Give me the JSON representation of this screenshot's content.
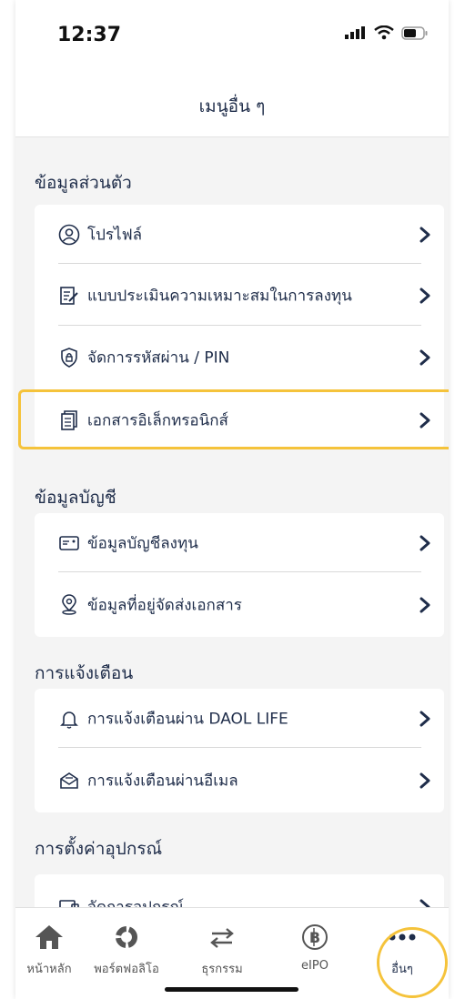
{
  "status": {
    "time": "12:37"
  },
  "header": {
    "title": "เมนูอื่น ๆ"
  },
  "sections": [
    {
      "title": "ข้อมูลส่วนตัว",
      "items": [
        {
          "label": "โปรไฟล์",
          "icon": "profile-icon"
        },
        {
          "label": "แบบประเมินความเหมาะสมในการลงทุน",
          "icon": "assessment-icon"
        },
        {
          "label": "จัดการรหัสผ่าน / PIN",
          "icon": "shield-lock-icon"
        },
        {
          "label": "เอกสารอิเล็กทรอนิกส์",
          "icon": "documents-icon"
        }
      ]
    },
    {
      "title": "ข้อมูลบัญชี",
      "items": [
        {
          "label": "ข้อมูลบัญชีลงทุน",
          "icon": "account-card-icon"
        },
        {
          "label": "ข้อมูลที่อยู่จัดส่งเอกสาร",
          "icon": "location-pin-icon"
        }
      ]
    },
    {
      "title": "การแจ้งเตือน",
      "items": [
        {
          "label": "การแจ้งเตือนผ่าน DAOL LIFE",
          "icon": "bell-icon"
        },
        {
          "label": "การแจ้งเตือนผ่านอีเมล",
          "icon": "email-icon"
        }
      ]
    },
    {
      "title": "การตั้งค่าอุปกรณ์",
      "items": [
        {
          "label": "จัดการอุปกรณ์",
          "icon": "device-icon"
        }
      ]
    }
  ],
  "tabbar": [
    {
      "label": "หน้าหลัก",
      "icon": "home-icon"
    },
    {
      "label": "พอร์ตฟอลิโอ",
      "icon": "portfolio-icon"
    },
    {
      "label": "ธุรกรรม",
      "icon": "transaction-arrows-icon"
    },
    {
      "label": "eIPO",
      "icon": "eipo-coin-icon"
    },
    {
      "label": "อื่นๆ",
      "icon": "more-dots-icon",
      "active": true
    }
  ],
  "colors": {
    "text": "#1f2d4a",
    "highlight": "#f5c33b",
    "background": "#f4f4f4"
  }
}
